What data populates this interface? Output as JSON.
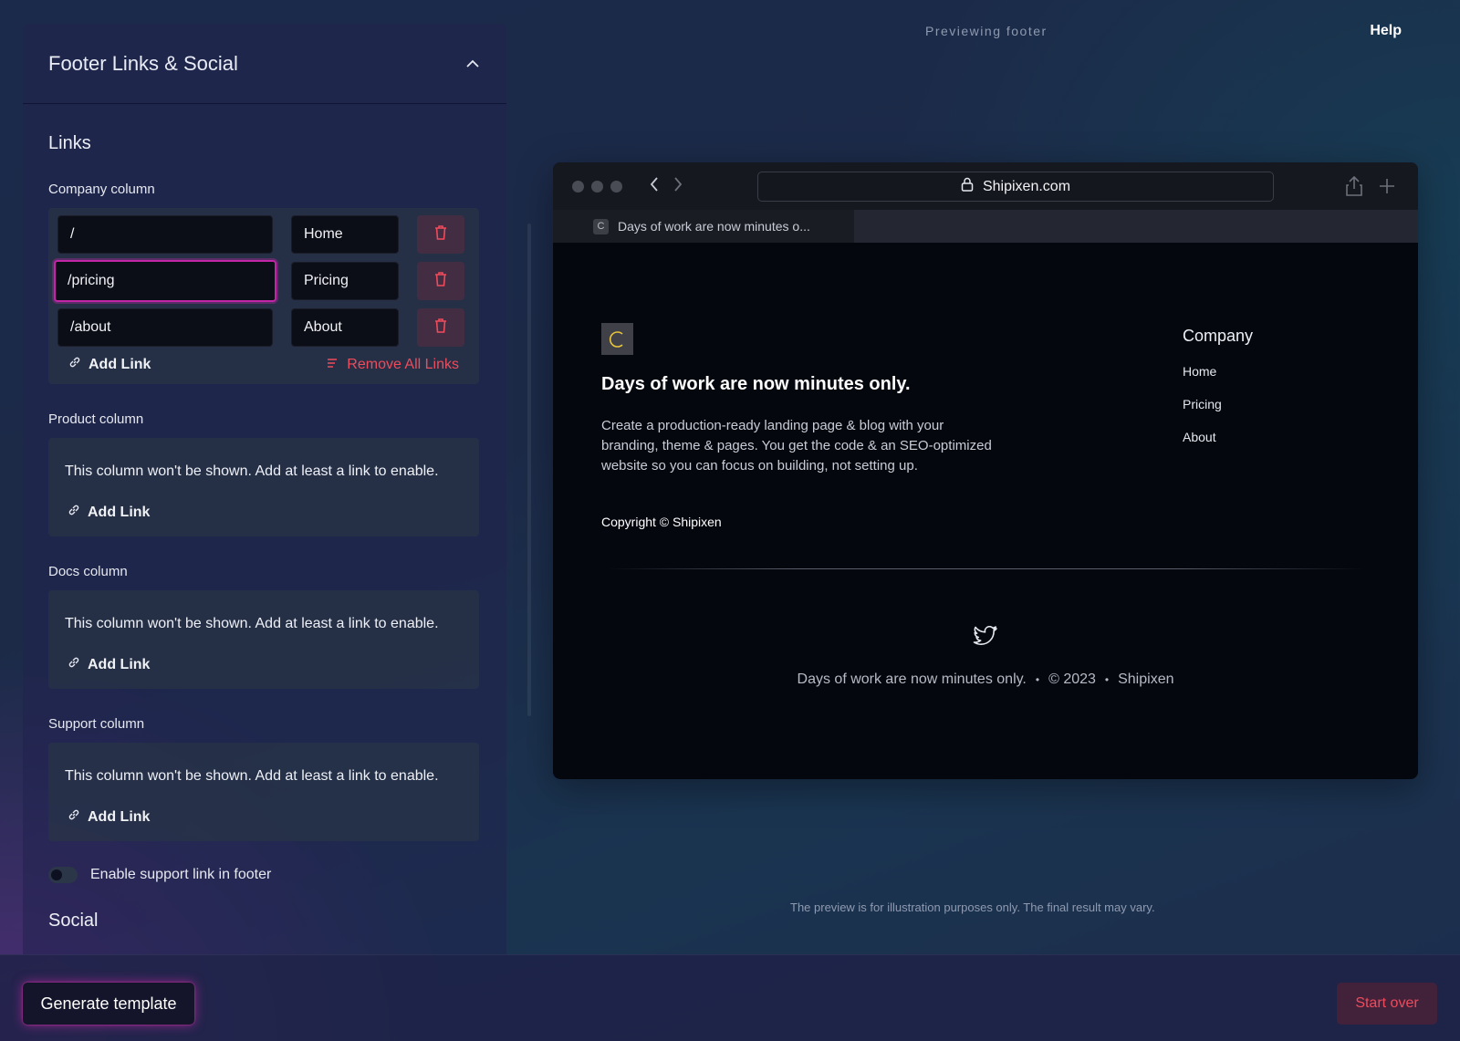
{
  "editor": {
    "title": "Footer Links & Social",
    "links_section": "Links",
    "company": {
      "label": "Company column",
      "rows": [
        {
          "url": "/",
          "name": "Home"
        },
        {
          "url": "/pricing",
          "name": "Pricing"
        },
        {
          "url": "/about",
          "name": "About"
        }
      ],
      "add_link": "Add Link",
      "remove_all": "Remove All Links"
    },
    "product": {
      "label": "Product column",
      "empty_text": "This column won't be shown. Add at least a link to enable.",
      "add_link": "Add Link"
    },
    "docs": {
      "label": "Docs column",
      "empty_text": "This column won't be shown. Add at least a link to enable.",
      "add_link": "Add Link"
    },
    "support": {
      "label": "Support column",
      "empty_text": "This column won't be shown. Add at least a link to enable.",
      "add_link": "Add Link"
    },
    "toggle_label": "Enable support link in footer",
    "social_section": "Social"
  },
  "header": {
    "preview_label": "Previewing footer",
    "help": "Help"
  },
  "browser": {
    "url": "Shipixen.com",
    "tab_title": "Days of work are now minutes o...",
    "tab_favicon": "C"
  },
  "site": {
    "logo_letter": "C",
    "title": "Days of work are now minutes only.",
    "description": "Create a production-ready landing page & blog with your branding, theme & pages. You get the code & an SEO-optimized website so you can focus on building, not setting up.",
    "copyright": "Copyright © Shipixen",
    "company_heading": "Company",
    "company_links": [
      "Home",
      "Pricing",
      "About"
    ],
    "bottom_tagline": "Days of work are now minutes only.",
    "bottom_year": "© 2023",
    "bottom_brand": "Shipixen"
  },
  "disclaimer": "The preview is for illustration purposes only. The final result may vary.",
  "actions": {
    "generate": "Generate template",
    "start_over": "Start over"
  },
  "icons": {
    "collapse": "chevron-up-icon",
    "delete": "trash-icon",
    "add": "link-icon",
    "remove_all": "list-remove-icon",
    "lock": "lock-icon",
    "social": "twitter-icon"
  },
  "colors": {
    "accent": "#c026a6",
    "danger": "#ef4b5b",
    "logo_letter": "#e8c53a"
  }
}
